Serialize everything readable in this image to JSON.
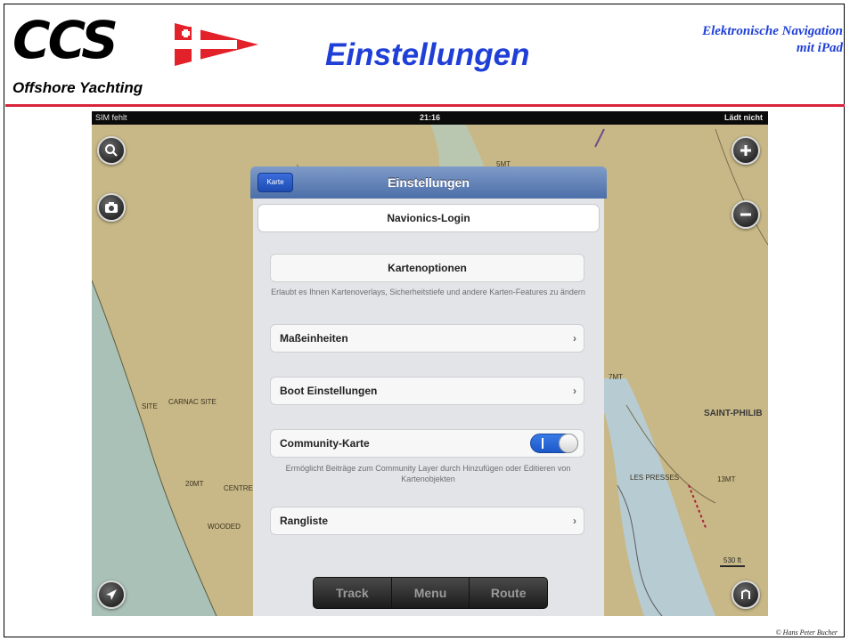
{
  "header": {
    "logo_text": "CCS",
    "logo_subtitle": "Offshore Yachting",
    "title": "Einstellungen",
    "right_line1": "Elektronische Navigation",
    "right_line2": "mit  iPad"
  },
  "footer": {
    "copyright": "© Hans Peter Bucher"
  },
  "colors": {
    "title_blue": "#1f3fd6",
    "rule_red": "#d8233a",
    "toggle_blue": "#1c58c8"
  },
  "statusbar": {
    "carrier": "SIM fehlt",
    "time": "21:16",
    "battery": "Lädt nicht"
  },
  "map": {
    "labels": [
      "SITE",
      "CARNAC SITE",
      "20MT",
      "CENTRE VACAN",
      "WOODED",
      "SAINT-PHILIB",
      "LES PRESSES",
      "13MT",
      "7MT",
      "5MT"
    ],
    "scale": "530 ft"
  },
  "popover": {
    "back_button": "Karte",
    "title": "Einstellungen",
    "login": "Navionics-Login",
    "map_options": "Kartenoptionen",
    "map_options_note": "Erlaubt es Ihnen Kartenoverlays, Sicherheitstiefe und andere Karten-Features zu ändern",
    "units": "Maßeinheiten",
    "boat_settings": "Boot Einstellungen",
    "community": "Community-Karte",
    "community_on": true,
    "community_note": "Ermöglicht Beiträge zum Community Layer durch Hinzufügen oder Editieren von Kartenobjekten",
    "ranking": "Rangliste"
  },
  "toolbar": {
    "track": "Track",
    "menu": "Menu",
    "route": "Route"
  },
  "icons": [
    "search-icon",
    "camera-icon",
    "zoom-in-icon",
    "zoom-out-icon",
    "locate-arrow-icon",
    "chart-settings-icon",
    "wifi-icon",
    "battery-icon"
  ]
}
